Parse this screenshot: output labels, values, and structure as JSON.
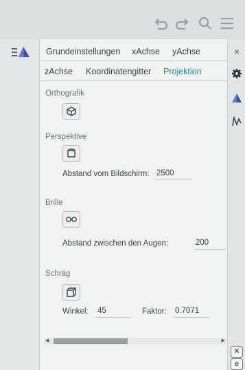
{
  "toolbar": {
    "undo_icon": "undo-icon",
    "redo_icon": "redo-icon",
    "search_icon": "search-icon",
    "menu_icon": "menu-icon"
  },
  "tabs": {
    "row1": [
      "Grundeinstellungen",
      "xAchse",
      "yAchse"
    ],
    "row2": [
      "zAchse",
      "Koordinatengitter",
      "Projektion"
    ],
    "active": "Projektion"
  },
  "projection": {
    "orthografik_label": "Orthografik",
    "perspektive_label": "Perspektive",
    "abstand_bildschirm_label": "Abstand vom Bildschirm:",
    "abstand_bildschirm_value": "2500",
    "brille_label": "Brille",
    "abstand_augen_label": "Abstand zwischen den Augen:",
    "abstand_augen_value": "200",
    "schraeg_label": "Schräg",
    "winkel_label": "Winkel:",
    "winkel_value": "45",
    "faktor_label": "Faktor:",
    "faktor_value": "0.7071"
  },
  "sidebar_right": {
    "close": "×",
    "bottom_close": "✕",
    "bottom_e": "e"
  },
  "colors": {
    "accent": "#1b8b87",
    "brand_blue": "#3b4fa0"
  }
}
